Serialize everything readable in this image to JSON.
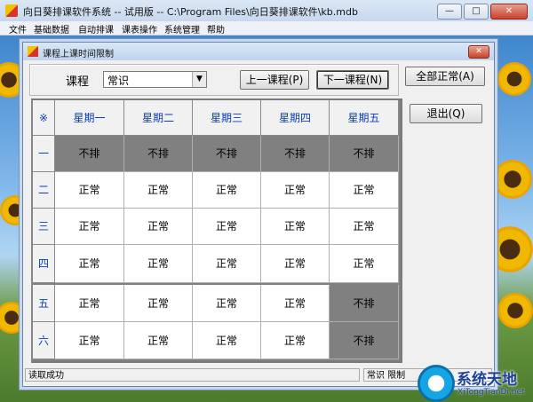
{
  "app": {
    "title": "向日葵排课软件系统 -- 试用版  -- C:\\Program Files\\向日葵排课软件\\kb.mdb",
    "window_buttons": [
      "—",
      "□",
      "✕"
    ]
  },
  "menu": [
    "文件",
    "基础数据",
    "自动排课",
    "课表操作",
    "系统管理",
    "帮助"
  ],
  "dialog": {
    "title": "课程上课时间限制",
    "close": "✕",
    "course_label": "课程",
    "course_value": "常识",
    "prev_button": "上一课程(P)",
    "next_button": "下一课程(N)",
    "all_normal_button": "全部正常(A)",
    "exit_button": "退出(Q)"
  },
  "grid": {
    "corner": "※",
    "days": [
      "星期一",
      "星期二",
      "星期三",
      "星期四",
      "星期五"
    ],
    "periods": [
      "一",
      "二",
      "三",
      "四",
      "五",
      "六"
    ],
    "rows": [
      [
        "不排",
        "不排",
        "不排",
        "不排",
        "不排"
      ],
      [
        "正常",
        "正常",
        "正常",
        "正常",
        "正常"
      ],
      [
        "正常",
        "正常",
        "正常",
        "正常",
        "正常"
      ],
      [
        "正常",
        "正常",
        "正常",
        "正常",
        "正常"
      ],
      [
        "正常",
        "正常",
        "正常",
        "正常",
        "不排"
      ],
      [
        "正常",
        "正常",
        "正常",
        "正常",
        "不排"
      ]
    ]
  },
  "status": {
    "left": "读取成功",
    "right": "常识  限制"
  },
  "watermark": {
    "title": "系统天地",
    "url": "XiTongTianDi.net"
  }
}
